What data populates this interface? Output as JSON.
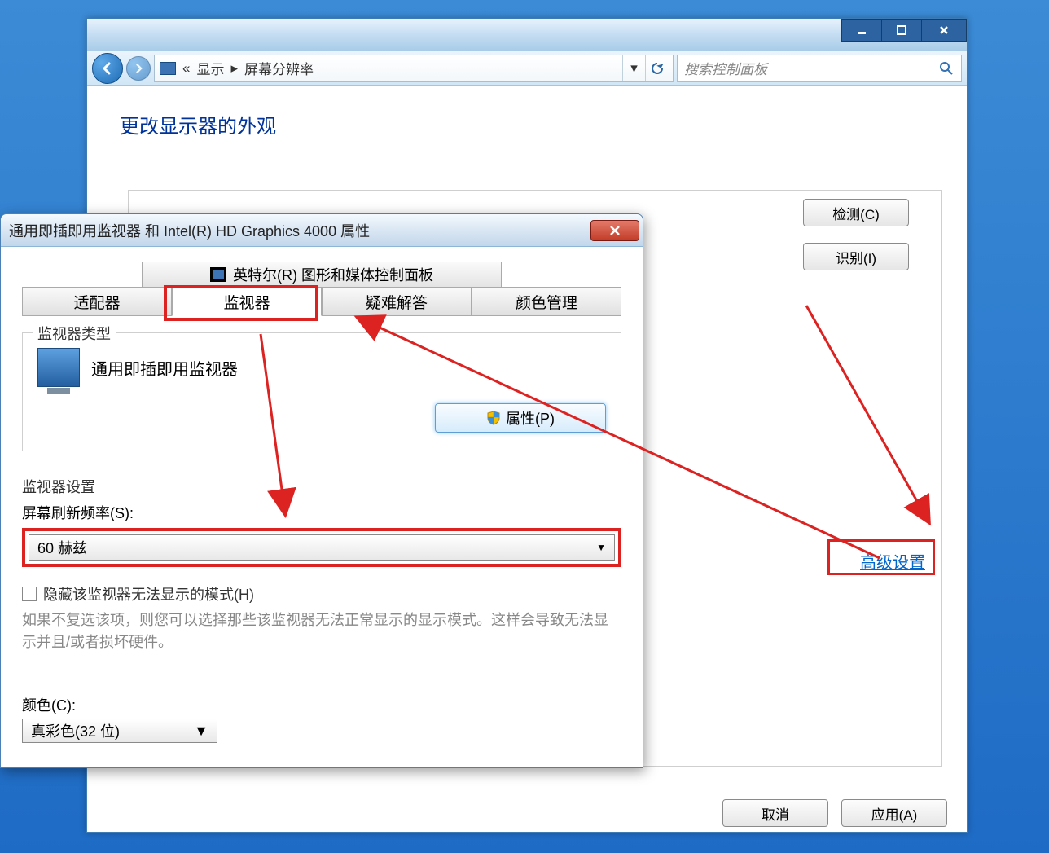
{
  "parentWindow": {
    "breadcrumb_prefix": "«",
    "breadcrumb1": "显示",
    "breadcrumb_sep": "▸",
    "breadcrumb2": "屏幕分辨率",
    "searchPlaceholder": "搜索控制面板",
    "heading": "更改显示器的外观",
    "detectBtn": "检测(C)",
    "identifyBtn": "识别(I)",
    "advancedLink": "高级设置",
    "cancelBtn": "取消",
    "applyBtn": "应用(A)"
  },
  "dialog": {
    "title": "通用即插即用监视器 和 Intel(R) HD Graphics 4000 属性",
    "topTab": "英特尔(R) 图形和媒体控制面板",
    "tabs": {
      "adapter": "适配器",
      "monitor": "监视器",
      "troubleshoot": "疑难解答",
      "colorMgmt": "颜色管理"
    },
    "monitorTypeLegend": "监视器类型",
    "monitorName": "通用即插即用监视器",
    "propertiesBtn": "属性(P)",
    "monitorSettingsLegend": "监视器设置",
    "refreshRateLabel": "屏幕刷新频率(S):",
    "refreshRateValue": "60 赫兹",
    "hideModesCheckbox": "隐藏该监视器无法显示的模式(H)",
    "hideModesHint": "如果不复选该项，则您可以选择那些该监视器无法正常显示的显示模式。这样会导致无法显示并且/或者损坏硬件。",
    "colorLabel": "颜色(C):",
    "colorValue": "真彩色(32 位)"
  }
}
